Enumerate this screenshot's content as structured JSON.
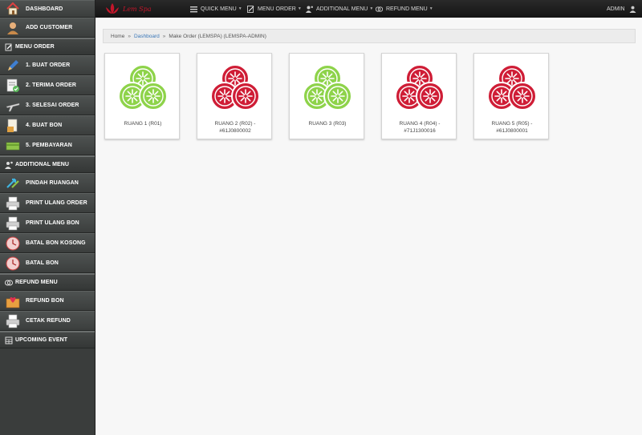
{
  "sidebar": {
    "items": [
      {
        "label": "DASHBOARD",
        "icon": "home-icon"
      },
      {
        "label": "ADD CUSTOMER",
        "icon": "user-icon"
      },
      {
        "label": "MENU ORDER",
        "icon": "edit-icon"
      },
      {
        "label": "1. BUAT ORDER",
        "icon": "pencil-icon"
      },
      {
        "label": "2. TERIMA ORDER",
        "icon": "document-check-icon"
      },
      {
        "label": "3. SELESAI ORDER",
        "icon": "plane-icon"
      },
      {
        "label": "4. BUAT BON",
        "icon": "receipt-icon"
      },
      {
        "label": "5. PEMBAYARAN",
        "icon": "cash-icon"
      },
      {
        "label": "ADDITIONAL MENU",
        "icon": "user-gear-icon"
      },
      {
        "label": "PINDAH RUANGAN",
        "icon": "arrows-icon"
      },
      {
        "label": "PRINT ULANG ORDER",
        "icon": "printer-icon"
      },
      {
        "label": "PRINT ULANG BON",
        "icon": "printer-icon"
      },
      {
        "label": "BATAL BON KOSONG",
        "icon": "clock-icon"
      },
      {
        "label": "BATAL BON",
        "icon": "clock-icon"
      },
      {
        "label": "REFUND MENU",
        "icon": "coins-icon"
      },
      {
        "label": "REFUND BON",
        "icon": "heart-box-icon"
      },
      {
        "label": "CETAK REFUND",
        "icon": "printer-icon"
      },
      {
        "label": "UPCOMING EVENT",
        "icon": "calendar-icon"
      }
    ]
  },
  "topbar": {
    "logo_text": "Lem Spa",
    "menus": [
      {
        "label": "QUICK MENU"
      },
      {
        "label": "MENU ORDER"
      },
      {
        "label": "ADDITIONAL MENU"
      },
      {
        "label": "REFUND MENU"
      }
    ],
    "user": "ADMIN"
  },
  "breadcrumb": {
    "home": "Home",
    "dashboard": "Dashboard",
    "current": "Make Order (LEMSPA) (LEMSPA-ADMIN)"
  },
  "rooms": [
    {
      "line1": "RUANG 1 (R01)",
      "line2": "",
      "status": "available",
      "color": "#8ed34a"
    },
    {
      "line1": "RUANG 2 (R02) -",
      "line2": "#61J0800002",
      "status": "occupied",
      "color": "#cf1d36"
    },
    {
      "line1": "RUANG 3 (R03)",
      "line2": "",
      "status": "available",
      "color": "#8ed34a"
    },
    {
      "line1": "RUANG 4 (R04) -",
      "line2": "#71J1300016",
      "status": "occupied",
      "color": "#cf1d36"
    },
    {
      "line1": "RUANG 5 (R05) -",
      "line2": "#61J0800001",
      "status": "occupied",
      "color": "#cf1d36"
    }
  ],
  "colors": {
    "available": "#8ed34a",
    "occupied": "#cf1d36",
    "link": "#3a77b8"
  }
}
